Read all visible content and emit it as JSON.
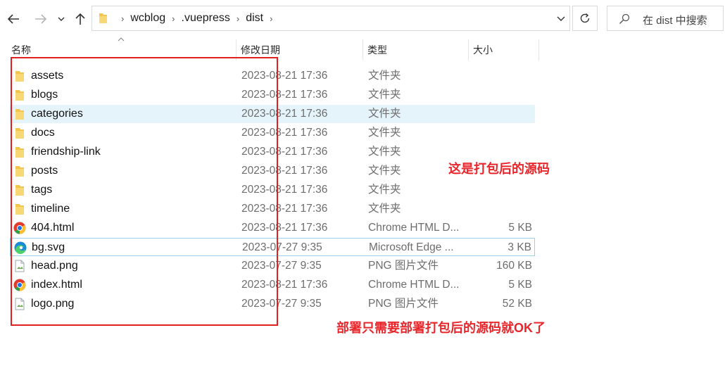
{
  "nav": {
    "breadcrumb": [
      "wcblog",
      ".vuepress",
      "dist"
    ],
    "search_placeholder": "在 dist 中搜索"
  },
  "columns": {
    "name": "名称",
    "date": "修改日期",
    "type": "类型",
    "size": "大小"
  },
  "files": [
    {
      "name": "assets",
      "date": "2023-08-21 17:36",
      "type": "文件夹",
      "size": "",
      "icon": "folder-icon"
    },
    {
      "name": "blogs",
      "date": "2023-08-21 17:36",
      "type": "文件夹",
      "size": "",
      "icon": "folder-icon"
    },
    {
      "name": "categories",
      "date": "2023-08-21 17:36",
      "type": "文件夹",
      "size": "",
      "icon": "folder-icon",
      "selected": true
    },
    {
      "name": "docs",
      "date": "2023-08-21 17:36",
      "type": "文件夹",
      "size": "",
      "icon": "folder-icon"
    },
    {
      "name": "friendship-link",
      "date": "2023-08-21 17:36",
      "type": "文件夹",
      "size": "",
      "icon": "folder-icon"
    },
    {
      "name": "posts",
      "date": "2023-08-21 17:36",
      "type": "文件夹",
      "size": "",
      "icon": "folder-icon"
    },
    {
      "name": "tags",
      "date": "2023-08-21 17:36",
      "type": "文件夹",
      "size": "",
      "icon": "folder-icon"
    },
    {
      "name": "timeline",
      "date": "2023-08-21 17:36",
      "type": "文件夹",
      "size": "",
      "icon": "folder-icon"
    },
    {
      "name": "404.html",
      "date": "2023-08-21 17:36",
      "type": "Chrome HTML D...",
      "size": "5 KB",
      "icon": "chrome-icon"
    },
    {
      "name": "bg.svg",
      "date": "2023-07-27 9:35",
      "type": "Microsoft Edge ...",
      "size": "3 KB",
      "icon": "edge-icon",
      "focused": true
    },
    {
      "name": "head.png",
      "date": "2023-07-27 9:35",
      "type": "PNG 图片文件",
      "size": "160 KB",
      "icon": "png-file-icon"
    },
    {
      "name": "index.html",
      "date": "2023-08-21 17:36",
      "type": "Chrome HTML D...",
      "size": "5 KB",
      "icon": "chrome-icon"
    },
    {
      "name": "logo.png",
      "date": "2023-07-27 9:35",
      "type": "PNG 图片文件",
      "size": "52 KB",
      "icon": "png-file-icon"
    }
  ],
  "annotations": {
    "note1": "这是打包后的源码",
    "note2": "部署只需要部署打包后的源码就OK了"
  },
  "colors": {
    "annotation": "#e8262b",
    "folder": "#f3c54f",
    "selection": "#e5f3fb"
  }
}
